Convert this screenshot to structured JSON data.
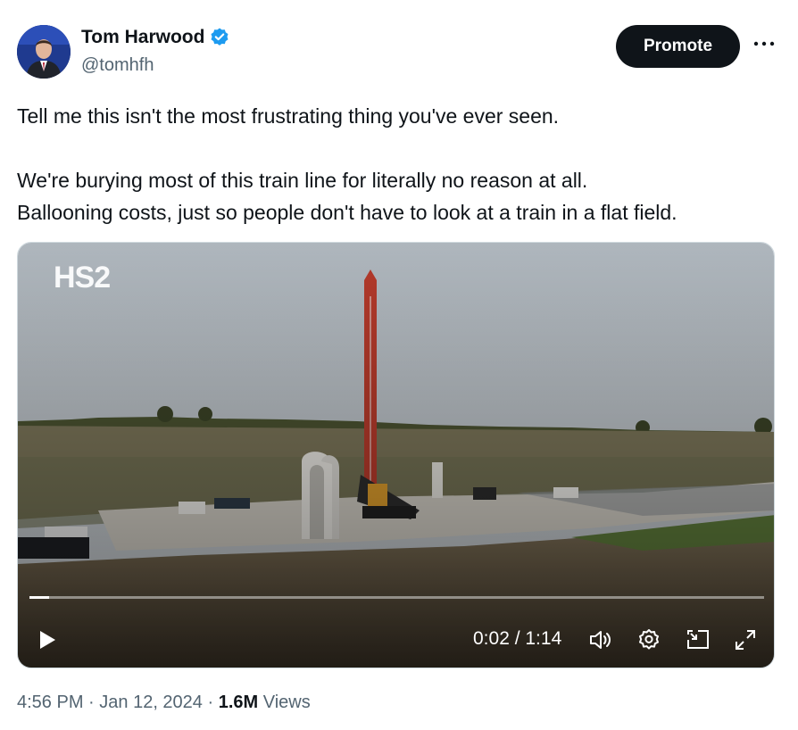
{
  "author": {
    "name": "Tom Harwood",
    "handle": "@tomhfh",
    "verified": true
  },
  "actions": {
    "promote_label": "Promote",
    "more_icon": "more-horizontal-icon"
  },
  "tweet": {
    "line1": "Tell me this isn't the most frustrating thing you've ever seen.",
    "line2": "We're burying most of this train line for literally no reason at all.",
    "line3": "Ballooning costs, just so people don't have to look at a train in a flat field."
  },
  "video": {
    "watermark": "HS2",
    "time_display": "0:02 / 1:14",
    "progress": 0.027,
    "icons": [
      "play-icon",
      "volume-icon",
      "settings-icon",
      "pip-icon",
      "fullscreen-icon"
    ]
  },
  "meta": {
    "time": "4:56 PM",
    "date": "Jan 12, 2024",
    "views_count": "1.6M",
    "views_label": "Views"
  },
  "colors": {
    "primary_text": "#0f1419",
    "secondary_text": "#536471",
    "verified_blue": "#1d9bf0"
  }
}
